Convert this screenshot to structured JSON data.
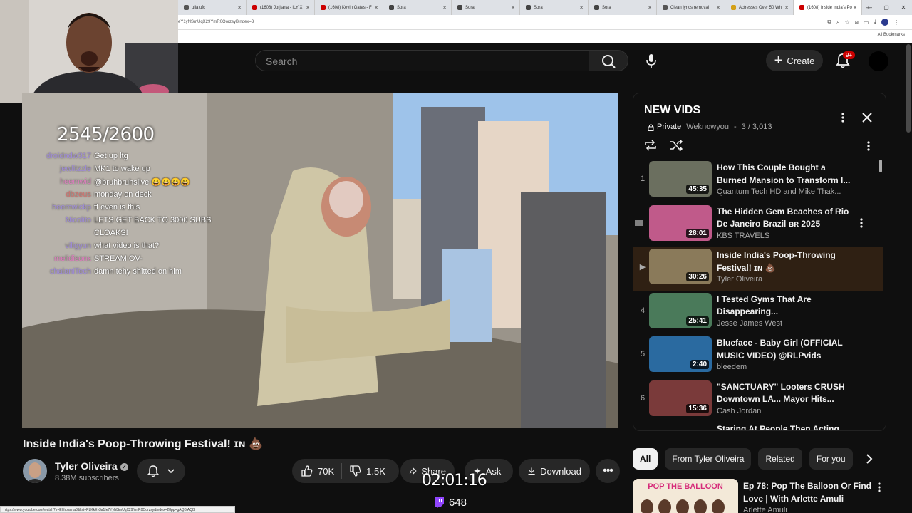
{
  "browser": {
    "tabs": [
      {
        "label": "ulla ufc",
        "color": "#555555"
      },
      {
        "label": "(1608) Jorjiana - ILY X",
        "color": "#cc0000"
      },
      {
        "label": "(1608) Kevin Gates - F",
        "color": "#cc0000"
      },
      {
        "label": "Sora",
        "color": "#444444"
      },
      {
        "label": "Sora",
        "color": "#444444"
      },
      {
        "label": "Sora",
        "color": "#444444"
      },
      {
        "label": "Sora",
        "color": "#444444"
      },
      {
        "label": "Clean lyrics removal",
        "color": "#555555"
      },
      {
        "label": "Actresses Over 50 Wh",
        "color": "#d4a017"
      },
      {
        "label": "(1608) Inside India's Po",
        "color": "#cc0000"
      }
    ],
    "address": "eY1yNSmUqX29YmR0OorzsyBindex=3",
    "all_bookmarks": "All Bookmarks",
    "status_url": "https://www.youtube.com/watch?v=Ehhoacrta8&list=PLKkEv3a1Ie7YyNSmUqX29YmR0Oorzsy&index=28pp=gAQBiAQB"
  },
  "header": {
    "search_placeholder": "Search",
    "create_label": "Create",
    "notifications_badge": "9+"
  },
  "overlay": {
    "sub_goal": "2545/2600",
    "chat": [
      {
        "user": "droidndw317",
        "msg": "Get up ltg",
        "color": "purple"
      },
      {
        "user": "jewlitzzle",
        "msg": "MK1 to wake up",
        "color": "purple"
      },
      {
        "user": "heemwid",
        "msg": "@bruhbruhslive 😄😄😄😄",
        "color": "pink"
      },
      {
        "user": "dbzeus",
        "msg": "monday on deck",
        "color": "red"
      },
      {
        "user": "heemwickp",
        "msg": "tf even is this",
        "color": "purple"
      },
      {
        "user": "Nicolito",
        "msg": "LETS GET BACK TO 3000 SUBS",
        "color": "purple"
      },
      {
        "user": "",
        "msg": "CLOAKS!",
        "color": "purple"
      },
      {
        "user": "viligyun",
        "msg": "what video is that?",
        "color": "purple"
      },
      {
        "user": "melidisonx",
        "msg": "STREAM OV-",
        "color": "pink"
      },
      {
        "user": "chalaniTech",
        "msg": "damn tehy shitted on him",
        "color": "purple"
      }
    ],
    "stream_timer": "02:01:16",
    "viewers": "648"
  },
  "video": {
    "title": "Inside India's Poop-Throwing Festival! 🇮🇳 💩",
    "title_text": "Inside India's Poop-Throwing Festival! ɪɴ 💩",
    "channel": "Tyler Oliveira",
    "subscribers": "8.38M subscribers",
    "likes": "70K",
    "dislikes": "1.5K",
    "share": "Share",
    "ask": "Ask",
    "download": "Download"
  },
  "playlist": {
    "title": "NEW VIDS",
    "privacy": "Private",
    "owner": "Weknowyou",
    "position": "3 / 3,013",
    "items": [
      {
        "idx": "1",
        "title": "How This Couple Bought a Burned Mansion to Transform I...",
        "channel": "Quantum Tech HD and Mike Thak...",
        "duration": "45:35",
        "thumb": "#6b6f5f",
        "active": false
      },
      {
        "idx": "",
        "title": "The Hidden Gem Beaches of Rio De Janeiro Brazil ʙʀ 2025",
        "channel": "KBS TRAVELS",
        "duration": "28:01",
        "thumb": "#c05a8a",
        "active": false
      },
      {
        "idx": "▶",
        "title": "Inside India's Poop-Throwing Festival! ɪɴ 💩",
        "channel": "Tyler Oliveira",
        "duration": "30:26",
        "thumb": "#8a7a5a",
        "active": true
      },
      {
        "idx": "4",
        "title": "I Tested Gyms That Are Disappearing...",
        "channel": "Jesse James West",
        "duration": "25:41",
        "thumb": "#4a7a5a",
        "active": false
      },
      {
        "idx": "5",
        "title": "Blueface - Baby Girl (OFFICIAL MUSIC VIDEO) @RLPvids",
        "channel": "bleedem",
        "duration": "2:40",
        "thumb": "#2a6aa0",
        "active": false
      },
      {
        "idx": "6",
        "title": "\"SANCTUARY\" Looters CRUSH Downtown LA... Mayor Hits...",
        "channel": "Cash Jordan",
        "duration": "15:36",
        "thumb": "#7a3a3a",
        "active": false
      }
    ],
    "cut_title": "Staring At People Then Acting..."
  },
  "chips": [
    "All",
    "From Tyler Oliveira",
    "Related",
    "For you"
  ],
  "next_video": {
    "thumb_text": "POP THE BALLOON",
    "title": "Ep 78: Pop The Balloon Or Find Love | With Arlette Amuli",
    "channel": "Arlette Amuli"
  }
}
